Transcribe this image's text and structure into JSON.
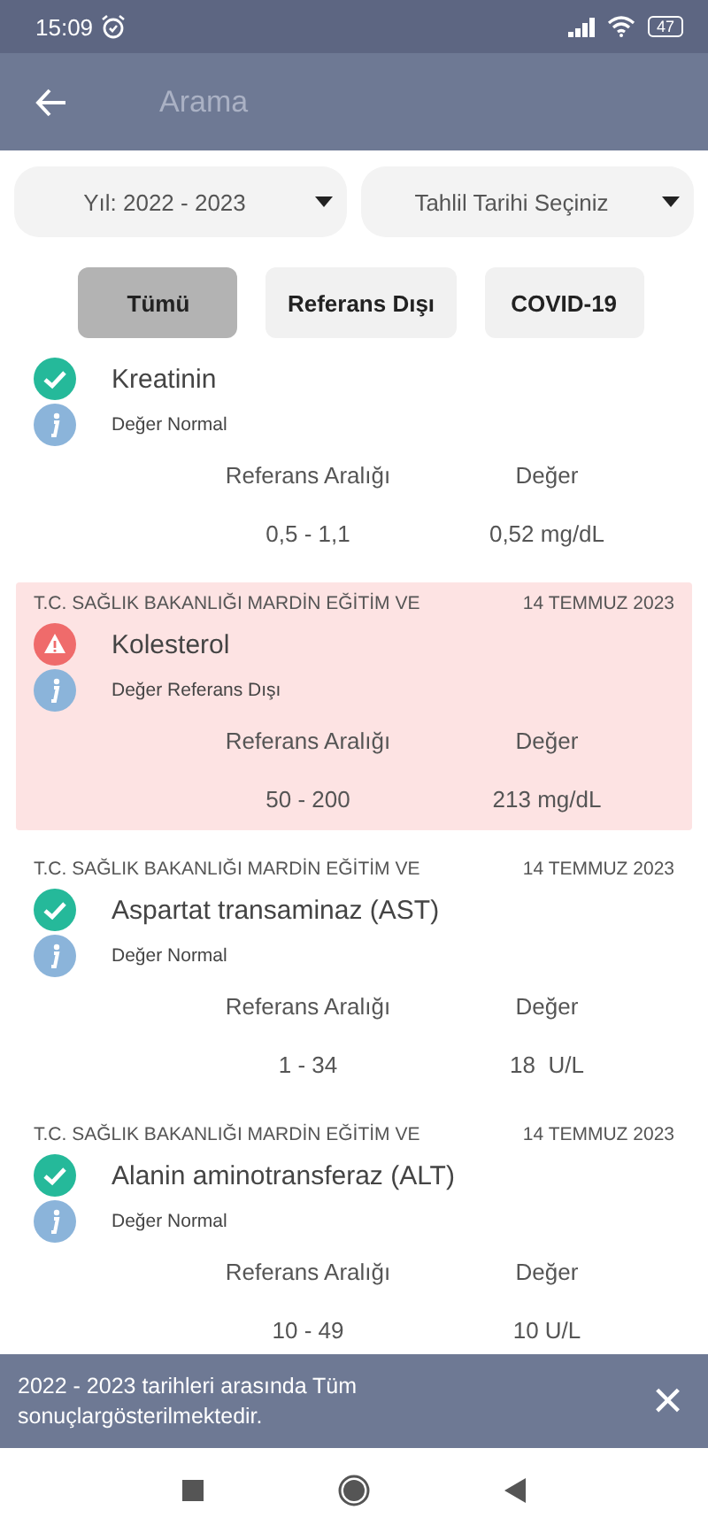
{
  "status_bar": {
    "time": "15:09",
    "battery": "47"
  },
  "app_bar": {
    "title": "Arama"
  },
  "dropdowns": [
    {
      "label": "Yıl: 2022 - 2023"
    },
    {
      "label": "Tahlil Tarihi Seçiniz"
    }
  ],
  "filters": [
    {
      "label": "Tümü",
      "selected": true
    },
    {
      "label": "Referans Dışı",
      "selected": false
    },
    {
      "label": "COVID-19",
      "selected": false
    }
  ],
  "results": [
    {
      "kind": "normal",
      "name": "Kreatinin",
      "status": "Değer Normal",
      "range_label": "Referans Aralığı",
      "value_label": "Değer",
      "range": "0,5 - 1,1",
      "value": "0,52 mg/dL"
    },
    {
      "kind": "out_of_range",
      "hospital": "T.C. SAĞLIK BAKANLIĞI MARDİN EĞİTİM VE",
      "date": "14 TEMMUZ 2023",
      "name": "Kolesterol",
      "status": "Değer Referans Dışı",
      "range_label": "Referans Aralığı",
      "value_label": "Değer",
      "range": "50 - 200",
      "value": "213 mg/dL"
    },
    {
      "kind": "normal",
      "hospital": "T.C. SAĞLIK BAKANLIĞI MARDİN EĞİTİM VE",
      "date": "14 TEMMUZ 2023",
      "name": "Aspartat transaminaz (AST)",
      "status": "Değer Normal",
      "range_label": "Referans Aralığı",
      "value_label": "Değer",
      "range": "1 - 34",
      "value": "18  U/L"
    },
    {
      "kind": "normal",
      "hospital": "T.C. SAĞLIK BAKANLIĞI MARDİN EĞİTİM VE",
      "date": "14 TEMMUZ 2023",
      "name": "Alanin aminotransferaz (ALT)",
      "status": "Değer Normal",
      "range_label": "Referans Aralığı",
      "value_label": "Değer",
      "range": "10 - 49",
      "value": "10 U/L"
    }
  ],
  "snackbar": {
    "message": "2022 - 2023 tarihleri arasında Tüm sonuçlargösterilmektedir.",
    "close": "×"
  }
}
